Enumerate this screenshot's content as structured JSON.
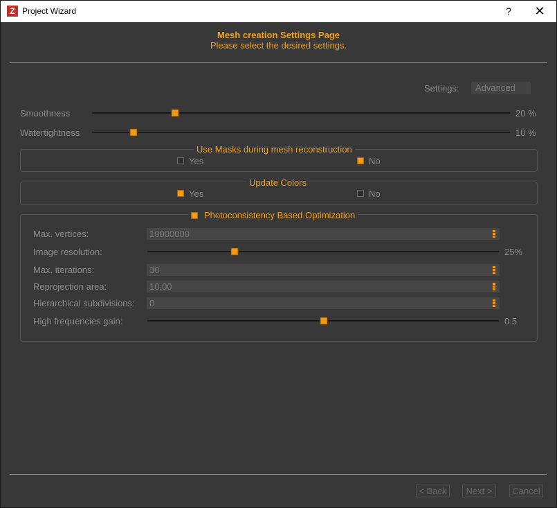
{
  "window": {
    "title": "Project Wizard",
    "help_glyph": "?",
    "close_glyph": "✕",
    "app_icon_letter": "Z"
  },
  "header": {
    "title": "Mesh creation Settings Page",
    "subtitle": "Please select the desired settings."
  },
  "settings": {
    "label": "Settings:",
    "value": "Advanced"
  },
  "sliders": {
    "smoothness": {
      "label": "Smoothness",
      "value": "20 %",
      "level": 0.2
    },
    "watertightness": {
      "label": "Watertightness",
      "value": "10 %",
      "level": 0.1
    }
  },
  "masks_group": {
    "title": "Use Masks during mesh reconstruction",
    "yes": "Yes",
    "no": "No",
    "selected": "No"
  },
  "colors_group": {
    "title": "Update Colors",
    "yes": "Yes",
    "no": "No",
    "selected": "Yes"
  },
  "photo_group": {
    "title": "Photoconsistency Based Optimization",
    "enabled": true,
    "max_vertices": {
      "label": "Max. vertices:",
      "value": "10000000"
    },
    "image_resolution": {
      "label": "Image resolution:",
      "value": "25%",
      "level": 0.25
    },
    "max_iterations": {
      "label": "Max. iterations:",
      "value": "30"
    },
    "reprojection_area": {
      "label": "Reprojection area:",
      "value": "10.00"
    },
    "hierarchical_subdivisions": {
      "label": "Hierarchical subdivisions:",
      "value": "0"
    },
    "high_frequencies_gain": {
      "label": "High frequencies gain:",
      "value": "0.5",
      "level": 0.5
    }
  },
  "footer": {
    "back": "< Back",
    "next": "Next >",
    "cancel": "Cancel"
  },
  "colors": {
    "accent": "#f0a020",
    "background": "#383838",
    "titlebar": "#ffffff"
  }
}
